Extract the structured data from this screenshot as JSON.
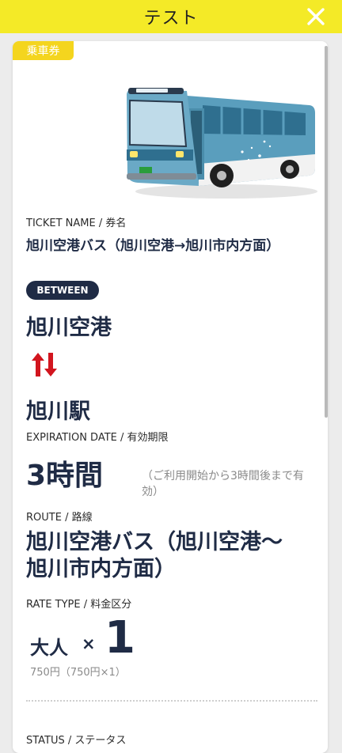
{
  "header": {
    "title": "テスト",
    "close_icon": "close-icon"
  },
  "ticket": {
    "badge": "乗車券",
    "ticket_name_label": "TICKET NAME / 券名",
    "ticket_name": "旭川空港バス（旭川空港→旭川市内方面）",
    "between_label": "BETWEEN",
    "from": "旭川空港",
    "to": "旭川駅",
    "swap_icon": "up-down-arrows-icon",
    "expiration_label": "EXPIRATION DATE / 有効期限",
    "expiration_value": "3時間",
    "expiration_note": "（ご利用開始から3時間後まで有効）",
    "route_label": "ROUTE / 路線",
    "route_value": "旭川空港バス（旭川空港～旭川市内方面）",
    "rate_type_label": "RATE TYPE / 料金区分",
    "rate_category": "大人",
    "multiply_sign": "×",
    "rate_count": "1",
    "rate_price": "750円（750円×1）",
    "status_label": "STATUS / ステータス"
  },
  "colors": {
    "header_bg": "#f4ea27",
    "badge_bg": "#f4d51e",
    "navy": "#1f2b45",
    "arrow_red": "#d2151e"
  }
}
